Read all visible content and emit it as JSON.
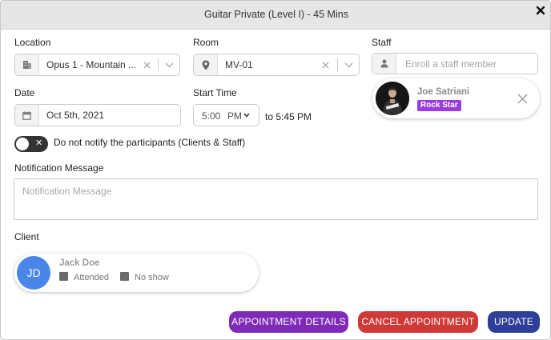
{
  "dialog": {
    "title": "Guitar Private (Level I) - 45 Mins"
  },
  "location": {
    "label": "Location",
    "value": "Opus 1 - Mountain ...",
    "icon": "building-icon"
  },
  "room": {
    "label": "Room",
    "value": "MV-01",
    "icon": "map-pin-icon"
  },
  "staff": {
    "label": "Staff",
    "placeholder": "Enroll a staff member",
    "icon": "person-icon",
    "member": {
      "name": "Joe Satriani",
      "badge": "Rock Star"
    }
  },
  "date": {
    "label": "Date",
    "value": "Oct 5th, 2021",
    "icon": "calendar-icon"
  },
  "start_time": {
    "label": "Start Time",
    "time": "5:00",
    "ampm": "PM",
    "end_text": "to 5:45 PM"
  },
  "notify_toggle": {
    "label": "Do not notify the participants (Clients & Staff)",
    "state": "off"
  },
  "notification": {
    "label": "Notification Message",
    "placeholder": "Notification Message"
  },
  "client": {
    "label": "Client",
    "initials": "JD",
    "name": "Jack Doe",
    "attended_label": "Attended",
    "noshow_label": "No show"
  },
  "buttons": {
    "details": "APPOINTMENT DETAILS",
    "cancel": "CANCEL APPOINTMENT",
    "update": "UPDATE"
  },
  "colors": {
    "details": "#7e2bb8",
    "cancel": "#cf3a37",
    "update": "#2e3f9a",
    "badge": "#9b3ce0",
    "client_avatar": "#4a86e8"
  }
}
